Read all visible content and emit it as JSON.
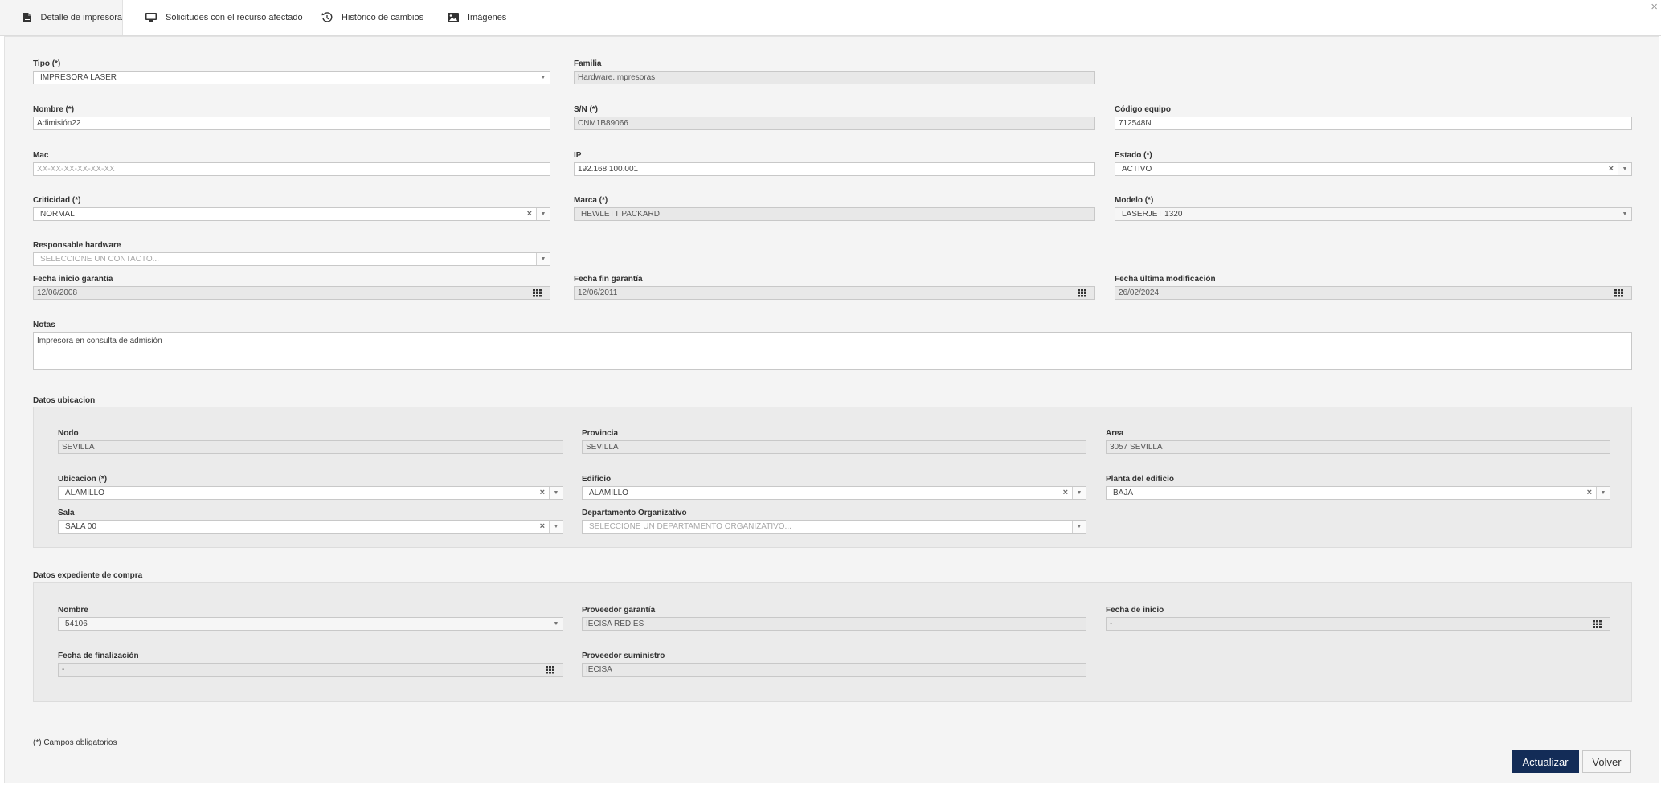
{
  "tabs": [
    {
      "label": "Detalle de impresora",
      "icon": "document-icon",
      "active": true
    },
    {
      "label": "Solicitudes con el recurso afectado",
      "icon": "monitor-icon"
    },
    {
      "label": "Histórico de cambios",
      "icon": "history-icon"
    },
    {
      "label": "Imágenes",
      "icon": "image-icon"
    }
  ],
  "close_label": "×",
  "form": {
    "tipo": {
      "label": "Tipo (*)",
      "value": "IMPRESORA LASER"
    },
    "familia": {
      "label": "Familia",
      "value": "Hardware.Impresoras"
    },
    "nombre": {
      "label": "Nombre (*)",
      "value": "Adimisión22"
    },
    "sn": {
      "label": "S/N (*)",
      "value": "CNM1B89066"
    },
    "codigo": {
      "label": "Código equipo",
      "value": "712548N"
    },
    "mac": {
      "label": "Mac",
      "placeholder": "XX-XX-XX-XX-XX-XX"
    },
    "ip": {
      "label": "IP",
      "value": "192.168.100.001"
    },
    "estado": {
      "label": "Estado (*)",
      "value": "ACTIVO"
    },
    "criticidad": {
      "label": "Criticidad (*)",
      "value": "NORMAL"
    },
    "marca": {
      "label": "Marca (*)",
      "value": "HEWLETT PACKARD"
    },
    "modelo": {
      "label": "Modelo (*)",
      "value": "LASERJET 1320"
    },
    "responsable": {
      "label": "Responsable hardware",
      "placeholder": "SELECCIONE UN CONTACTO..."
    },
    "fecha_inicio_garantia": {
      "label": "Fecha inicio garantía",
      "value": "12/06/2008"
    },
    "fecha_fin_garantia": {
      "label": "Fecha fin garantía",
      "value": "12/06/2011"
    },
    "fecha_ultima_mod": {
      "label": "Fecha última modificación",
      "value": "26/02/2024"
    },
    "notas": {
      "label": "Notas",
      "value": "Impresora en consulta de admisión"
    }
  },
  "ubicacion": {
    "title": "Datos ubicacion",
    "nodo": {
      "label": "Nodo",
      "value": "SEVILLA"
    },
    "provincia": {
      "label": "Provincia",
      "value": "SEVILLA"
    },
    "area": {
      "label": "Area",
      "value": "3057 SEVILLA"
    },
    "ubicacion": {
      "label": "Ubicacion (*)",
      "value": "ALAMILLO"
    },
    "edificio": {
      "label": "Edificio",
      "value": "ALAMILLO"
    },
    "planta": {
      "label": "Planta del edificio",
      "value": "BAJA"
    },
    "sala": {
      "label": "Sala",
      "value": "SALA 00"
    },
    "departamento": {
      "label": "Departamento Organizativo",
      "placeholder": "SELECCIONE UN DEPARTAMENTO ORGANIZATIVO..."
    }
  },
  "compra": {
    "title": "Datos expediente de compra",
    "nombre": {
      "label": "Nombre",
      "value": "54106"
    },
    "proveedor_garantia": {
      "label": "Proveedor garantía",
      "value": "IECISA RED ES"
    },
    "fecha_inicio": {
      "label": "Fecha de inicio",
      "value": "-"
    },
    "fecha_fin": {
      "label": "Fecha de finalización",
      "value": "-"
    },
    "proveedor_suministro": {
      "label": "Proveedor suministro",
      "value": "IECISA"
    }
  },
  "footer": {
    "note": "(*) Campos obligatorios",
    "actualizar": "Actualizar",
    "volver": "Volver"
  },
  "colors": {
    "primary_button": "#132c57",
    "panel_bg": "#f4f4f4"
  }
}
